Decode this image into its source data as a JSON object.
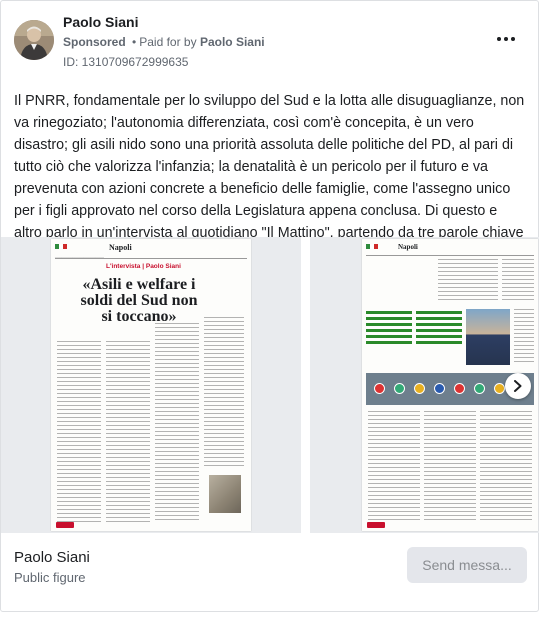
{
  "header": {
    "page_name": "Paolo Siani",
    "sponsored_label": "Sponsored",
    "separator": "•",
    "paid_for_by_label": "Paid for by",
    "paid_for_by_name": "Paolo Siani",
    "ad_id": "ID: 1310709672999635",
    "avatar_icon": "profile-photo"
  },
  "post": {
    "text": "Il PNRR, fondamentale per lo sviluppo del Sud e la lotta alle disuguaglianze, non va rinegoziato; l'autonomia differenziata, così com'è concepita, è un vero disastro; gli asili nido sono una priorità assoluta delle politiche del PD, al pari di tutto ciò che valorizza l'infanzia; la denatalità è un pericolo per il futuro e va prevenuta con azioni concrete a beneficio delle famiglie, come l'assegno unico per i figli approvato nel corso della Legislatura appena conclusa. Di questo e altro parlo in un'intervista al quotidiano \"Il Mattino\", partendo da tre parole chiave che…"
  },
  "carousel": {
    "slide1": {
      "newspaper": "Napoli",
      "kicker_prefix": "L'intervista",
      "kicker_name": "Paolo Siani",
      "headline": "«Asili e welfare i soldi del Sud non si toccano»"
    },
    "slide2": {
      "newspaper": "Napoli"
    },
    "next_icon": "chevron-right-icon"
  },
  "footer": {
    "name": "Paolo Siani",
    "category": "Public figure",
    "send_button": "Send messa..."
  },
  "colors": {
    "text_primary": "#1c1e21",
    "text_secondary": "#606770",
    "button_bg": "#e4e6eb",
    "button_text": "#8a8d91",
    "newspaper_red": "#c8102e"
  }
}
